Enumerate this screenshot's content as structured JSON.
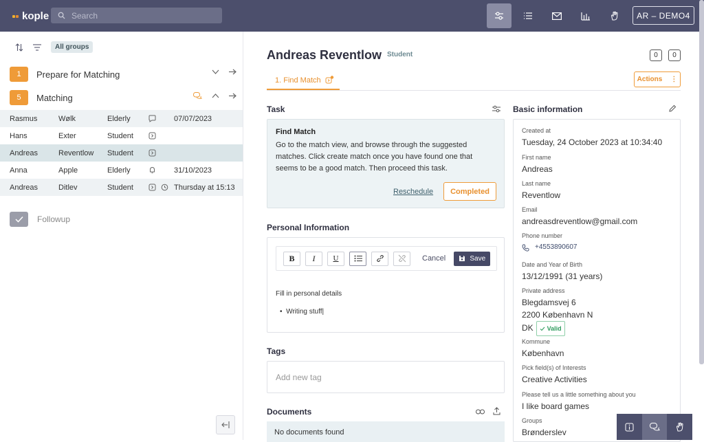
{
  "app": {
    "logo": "kople"
  },
  "search": {
    "placeholder": "Search"
  },
  "user": {
    "label": "AR – DEMO4"
  },
  "left": {
    "filter_pill": "All groups",
    "groups": [
      {
        "count": "1",
        "name": "Prepare for Matching"
      },
      {
        "count": "5",
        "name": "Matching"
      }
    ],
    "rows": [
      {
        "first": "Rasmus",
        "last": "Wølk",
        "type": "Elderly",
        "icon": "chat-icon",
        "date": "07/07/2023"
      },
      {
        "first": "Hans",
        "last": "Exter",
        "type": "Student",
        "icon": "step-icon",
        "date": ""
      },
      {
        "first": "Andreas",
        "last": "Reventlow",
        "type": "Student",
        "icon": "step-icon",
        "date": ""
      },
      {
        "first": "Anna",
        "last": "Apple",
        "type": "Elderly",
        "icon": "bell-icon",
        "date": "31/10/2023"
      },
      {
        "first": "Andreas",
        "last": "Ditlev",
        "type": "Student",
        "icon": "step-icon",
        "date": "Thursday at 15:13"
      }
    ],
    "followup": "Followup"
  },
  "profile": {
    "name": "Andreas Reventlow",
    "type": "Student",
    "counter_a": "0",
    "counter_b": "0",
    "tab": "1.  Find Match",
    "actions": "Actions"
  },
  "task": {
    "section": "Task",
    "title": "Find Match",
    "description": "Go to the match view, and browse through the suggested matches. Click create match once you have found one that seems to be a good match. Then proceed this task.",
    "reschedule": "Reschedule",
    "completed": "Completed"
  },
  "personal": {
    "section": "Personal Information",
    "cancel": "Cancel",
    "save": "Save",
    "text": "Fill in personal details",
    "bullet": "Writing stuff"
  },
  "tags": {
    "section": "Tags",
    "placeholder": "Add new tag"
  },
  "documents": {
    "section": "Documents",
    "empty": "No documents found"
  },
  "basic": {
    "section": "Basic information",
    "fields": [
      {
        "label": "Created at",
        "value": "Tuesday, 24 October 2023 at 10:34:40"
      },
      {
        "label": "First name",
        "value": "Andreas"
      },
      {
        "label": "Last name",
        "value": "Reventlow"
      },
      {
        "label": "Email",
        "value": "andreasdreventlow@gmail.com"
      },
      {
        "label": "Phone number",
        "value": "+4553890607"
      },
      {
        "label": "Date and Year of Birth",
        "value": "13/12/1991 (31 years)"
      },
      {
        "label": "Private address",
        "line1": "Blegdamsvej 6",
        "line2": "2200 København N",
        "line3": "DK",
        "valid": "Valid"
      },
      {
        "label": "Kommune",
        "value": "København"
      },
      {
        "label": "Pick field(s) of Interests",
        "value": "Creative Activities"
      },
      {
        "label": "Please tell us a little something about you",
        "value": "I like board games"
      },
      {
        "label": "Groups",
        "value": "Brønderslev"
      }
    ]
  }
}
